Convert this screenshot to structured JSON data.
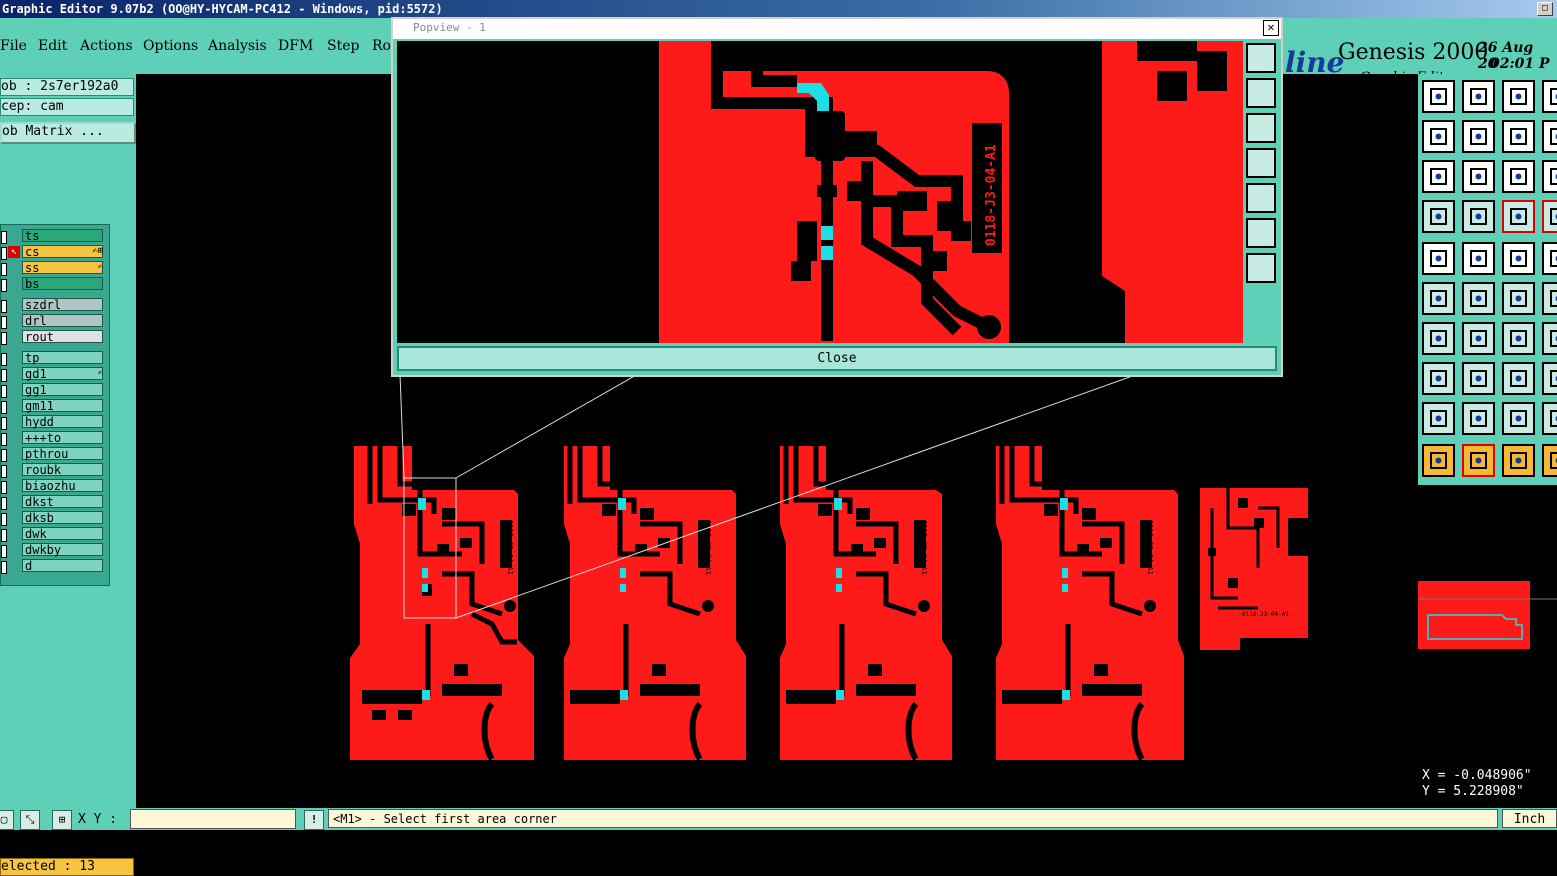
{
  "window": {
    "title": "Graphic Editor 9.07b2 (OO@HY-HYCAM-PC412 - Windows, pid:5572)",
    "control_icon": "maximize-icon"
  },
  "menu": {
    "items": [
      "File",
      "Edit",
      "Actions",
      "Options",
      "Analysis",
      "DFM",
      "Step",
      "Ro"
    ]
  },
  "brand": {
    "script": "line",
    "name": "Genesis 2000",
    "subtitle": "Graphic Editor",
    "date_line1": "26 Aug 20",
    "date_line2": "02:01 P"
  },
  "job": {
    "job_label": "ob : 2s7er192a0",
    "step_label": "cep: cam",
    "matrix_button": "ob Matrix ..."
  },
  "layers": [
    {
      "name": "ts",
      "color": "#2aa87a",
      "mark": ""
    },
    {
      "name": "cs",
      "color": "#f6c343",
      "mark": "✍⊞",
      "affected": true
    },
    {
      "name": "ss",
      "color": "#f6c343",
      "mark": "✍"
    },
    {
      "name": "bs",
      "color": "#2aa87a",
      "mark": ""
    },
    {
      "name": "szdrl",
      "color": "#b0c4c4",
      "mark": ""
    },
    {
      "name": "drl",
      "color": "#b0c4c4",
      "mark": ""
    },
    {
      "name": "rout",
      "color": "#e0e0e0",
      "mark": ""
    },
    {
      "name": "tp",
      "color": "#7fd4c0",
      "mark": ""
    },
    {
      "name": "gd1",
      "color": "#7fd4c0",
      "mark": "✍"
    },
    {
      "name": "gg1",
      "color": "#7fd4c0",
      "mark": ""
    },
    {
      "name": "gm11",
      "color": "#7fd4c0",
      "mark": ""
    },
    {
      "name": "hydd",
      "color": "#7fd4c0",
      "mark": ""
    },
    {
      "name": "+++to",
      "color": "#7fd4c0",
      "mark": ""
    },
    {
      "name": "pthrou",
      "color": "#7fd4c0",
      "mark": ""
    },
    {
      "name": "roubk",
      "color": "#7fd4c0",
      "mark": ""
    },
    {
      "name": "biaozhu",
      "color": "#7fd4c0",
      "mark": ""
    },
    {
      "name": "dkst",
      "color": "#7fd4c0",
      "mark": ""
    },
    {
      "name": "dksb",
      "color": "#7fd4c0",
      "mark": ""
    },
    {
      "name": "dwk",
      "color": "#7fd4c0",
      "mark": ""
    },
    {
      "name": "dwkby",
      "color": "#7fd4c0",
      "mark": ""
    },
    {
      "name": "d",
      "color": "#7fd4c0",
      "mark": ""
    }
  ],
  "selection": {
    "label": "elected : 13"
  },
  "popview": {
    "title": "Popview - 1",
    "close_label": "Close",
    "board_text": "0118-J3-04-A1",
    "close_icon": "close-icon"
  },
  "board_texts": [
    "0118-J3-04-A1",
    "0118-J3-04-A1",
    "0118-J3-04-A1",
    "0118-J3-04-A1",
    "0118-J3-04-A1"
  ],
  "colors": {
    "copper": "#ff1a1a",
    "highlight": "#1ae0e6",
    "panel": "#5fd0b8"
  },
  "status": {
    "xy_label": "X Y :",
    "xy_value": "",
    "message": "<M1> - Select first area corner",
    "units": "Inch",
    "alert_icon": "exclamation-icon"
  },
  "coordinates": {
    "x": "X = -0.048906\"",
    "y": "Y = 5.228908\""
  }
}
